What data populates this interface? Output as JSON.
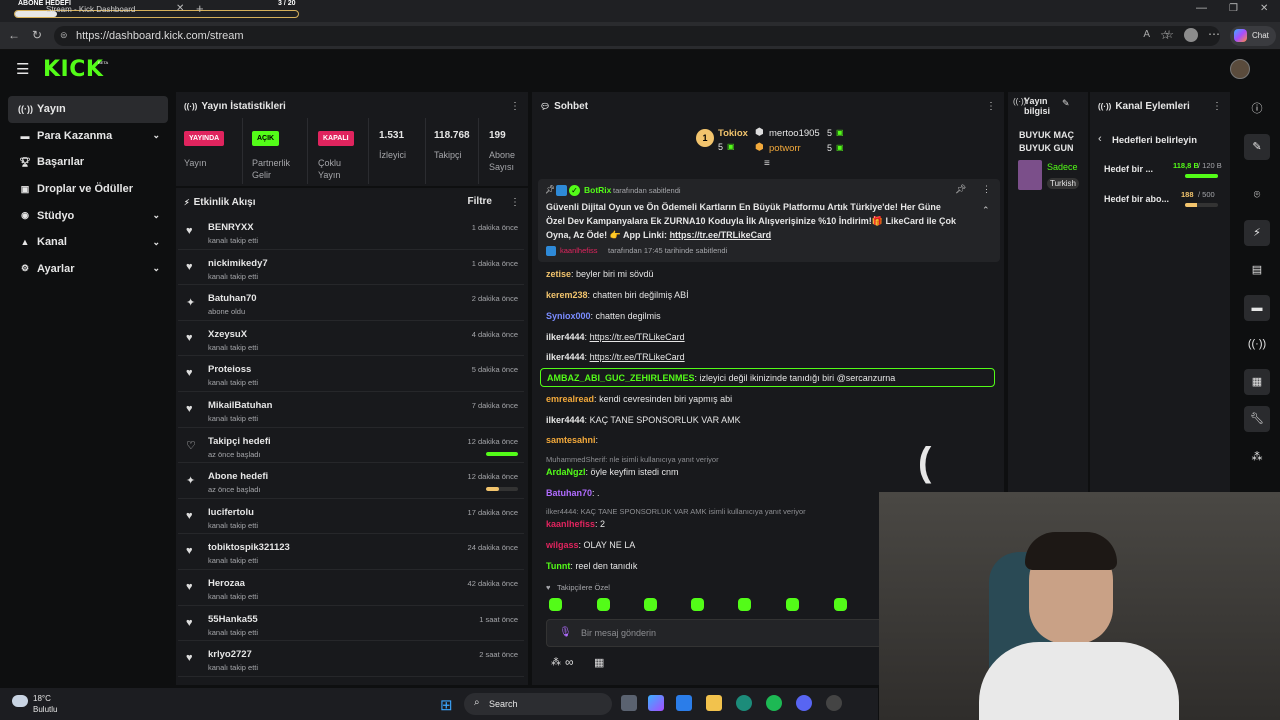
{
  "browser": {
    "tab_title": "Stream - Kick Dashboard",
    "url": "https://dashboard.kick.com/stream",
    "chat_label": "Chat"
  },
  "overlay": {
    "title": "ABONE HEDEFİ",
    "count": "3 / 20",
    "progress": 0.15
  },
  "nav": {
    "items": [
      {
        "label": "Yayın",
        "icon": "broadcast-icon",
        "active": true
      },
      {
        "label": "Para Kazanma",
        "icon": "money-icon"
      },
      {
        "label": "Başarılar",
        "icon": "trophy-icon"
      },
      {
        "label": "Droplar ve Ödüller",
        "icon": "gift-icon"
      },
      {
        "label": "Stüdyo",
        "icon": "camera-icon"
      },
      {
        "label": "Kanal",
        "icon": "person-icon"
      },
      {
        "label": "Ayarlar",
        "icon": "gear-icon"
      }
    ]
  },
  "stats": {
    "title": "Yayın İstatistikleri",
    "live_badge": "YAYINDA",
    "live_label": "Yayın",
    "partner_badge": "AÇIK",
    "partner_label": "Partnerlik Gelir",
    "multi_badge": "KAPALI",
    "multi_label": "Çoklu Yayın",
    "viewers": "1.531",
    "viewers_label": "İzleyici",
    "followers": "118.768",
    "followers_label": "Takipçi",
    "subs": "199",
    "subs_label": "Abone Sayısı"
  },
  "activity": {
    "title": "Etkinlik Akışı",
    "filter": "Filtre",
    "items": [
      {
        "name": "BENRYXX",
        "sub": "kanalı takip etti",
        "time": "1 dakika önce",
        "icon": "heart-icon"
      },
      {
        "name": "nickimikedy7",
        "sub": "kanalı takip etti",
        "time": "1 dakika önce",
        "icon": "heart-icon"
      },
      {
        "name": "Batuhan70",
        "sub": "abone oldu",
        "time": "2 dakika önce",
        "icon": "star-icon"
      },
      {
        "name": "XzeysuX",
        "sub": "kanalı takip etti",
        "time": "4 dakika önce",
        "icon": "heart-icon"
      },
      {
        "name": "Proteioss",
        "sub": "kanalı takip etti",
        "time": "5 dakika önce",
        "icon": "heart-icon"
      },
      {
        "name": "MikailBatuhan",
        "sub": "kanalı takip etti",
        "time": "7 dakika önce",
        "icon": "heart-icon"
      },
      {
        "name": "Takipçi hedefi",
        "sub": "az önce başladı",
        "time": "12 dakika önce",
        "icon": "heart-outline-icon",
        "progress": 1.0,
        "bar": "#53fc18"
      },
      {
        "name": "Abone hedefi",
        "sub": "az önce başladı",
        "time": "12 dakika önce",
        "icon": "star-icon",
        "progress": 0.4,
        "bar": "#f2c46d"
      },
      {
        "name": "lucifertolu",
        "sub": "kanalı takip etti",
        "time": "17 dakika önce",
        "icon": "heart-icon"
      },
      {
        "name": "tobiktospik321123",
        "sub": "kanalı takip etti",
        "time": "24 dakika önce",
        "icon": "heart-icon"
      },
      {
        "name": "Herozaa",
        "sub": "kanalı takip etti",
        "time": "42 dakika önce",
        "icon": "heart-icon"
      },
      {
        "name": "55Hanka55",
        "sub": "kanalı takip etti",
        "time": "1 saat önce",
        "icon": "heart-icon"
      },
      {
        "name": "krlyo2727",
        "sub": "kanalı takip etti",
        "time": "2 saat önce",
        "icon": "heart-icon"
      }
    ]
  },
  "chat": {
    "title": "Sohbet",
    "top": [
      {
        "rank": "1",
        "name": "Tokiox",
        "count": "5"
      },
      {
        "rank": "2",
        "name": "mertoo1905",
        "count": "5"
      },
      {
        "rank": "3",
        "name": "potworr",
        "count": "5"
      }
    ],
    "pinned": {
      "user": "BotRix",
      "by_label": "tarafından sabitlendi",
      "text1": "Güvenli Dijital Oyun ve Ön Ödemeli Kartların En Büyük Platformu Artık Türkiye'de! Her Güne",
      "text2": "Özel Dev Kampanyalara Ek ZURNA10 Koduyla İlk Alışverişinize %10 İndirim!🎁 LikeCard ile Çok",
      "text3": "Oyna, Az Öde! 👉 App Linki:",
      "link": "https://tr.ee/TRLikeCard",
      "pinner": "kaanlhefiss",
      "pinner_text": "tarafından 17:45 tarihinde sabitlendi"
    },
    "messages": [
      {
        "user": "zetise",
        "color": "#f2c46d",
        "text": "beyler biri mi sövdü"
      },
      {
        "user": "kerem238",
        "color": "#f2c46d",
        "text": "chatten biri değilmiş ABİ"
      },
      {
        "user": "Syniox000",
        "color": "#7a8cff",
        "text": "chatten degilmis"
      },
      {
        "user": "ilker4444",
        "color": "#e6e6e6",
        "text": "https://tr.ee/TRLikeCard"
      },
      {
        "user": "ilker4444",
        "color": "#e6e6e6",
        "text": "https://tr.ee/TRLikeCard"
      },
      {
        "user": "AMBAZ_ABI_GUC_ZEHIRLENMES",
        "color": "#53fc18",
        "text": "izleyici değil ikinizinde tanıdığı biri @sercanzurna"
      },
      {
        "user": "emrealread",
        "color": "#f2a93b",
        "text": "kendi cevresinden biri yapmış abi"
      },
      {
        "user": "ilker4444",
        "color": "#e6e6e6",
        "text": "KAÇ TANE SPONSORLUK VAR AMK"
      },
      {
        "user": "samtesahni",
        "color": "#f2a93b",
        "text": ""
      },
      {
        "user": "ArdaNgzl",
        "color": "#53fc18",
        "text": "öyle keyfim istedi cnm"
      },
      {
        "user": "Batuhan70",
        "color": "#b06cff",
        "text": "."
      },
      {
        "user": "kaanlhefiss",
        "color": "#e0245e",
        "text": "2"
      },
      {
        "user": "wilgass",
        "color": "#e0245e",
        "text": "OLAY NE LA"
      },
      {
        "user": "Tunnt",
        "color": "#53fc18",
        "text": "reel den tanıdık"
      }
    ],
    "reply1": "MuhammedSherif: nle isimli kullanıcıya yanıt veriyor",
    "reply2": "ilker4444: KAÇ TANE SPONSORLUK VAR AMK isimli kullanıcıya yanıt veriyor",
    "followers_only": "Takipçilere Özel",
    "placeholder": "Bir mesaj gönderin",
    "infinity": "∞"
  },
  "stream_info": {
    "title": "Yayın bilgisi",
    "line1": "BUYUK MAÇ",
    "line2": "BUYUK GUN",
    "category": "Sadece",
    "tag": "Turkish"
  },
  "channel_actions": {
    "title": "Kanal Eylemleri",
    "back": "Hedefleri belirleyin",
    "goals": [
      {
        "label": "Hedef bir ...",
        "value": "118,8 B",
        "target": "/ 120 B",
        "progress": 0.99,
        "color": "#53fc18"
      },
      {
        "label": "Hedef bir abo...",
        "value": "188",
        "target": "/ 500",
        "progress": 0.376,
        "color": "#f2c46d"
      }
    ]
  },
  "taskbar": {
    "weather_temp": "18°C",
    "weather_desc": "Bulutlu",
    "search": "Search"
  }
}
